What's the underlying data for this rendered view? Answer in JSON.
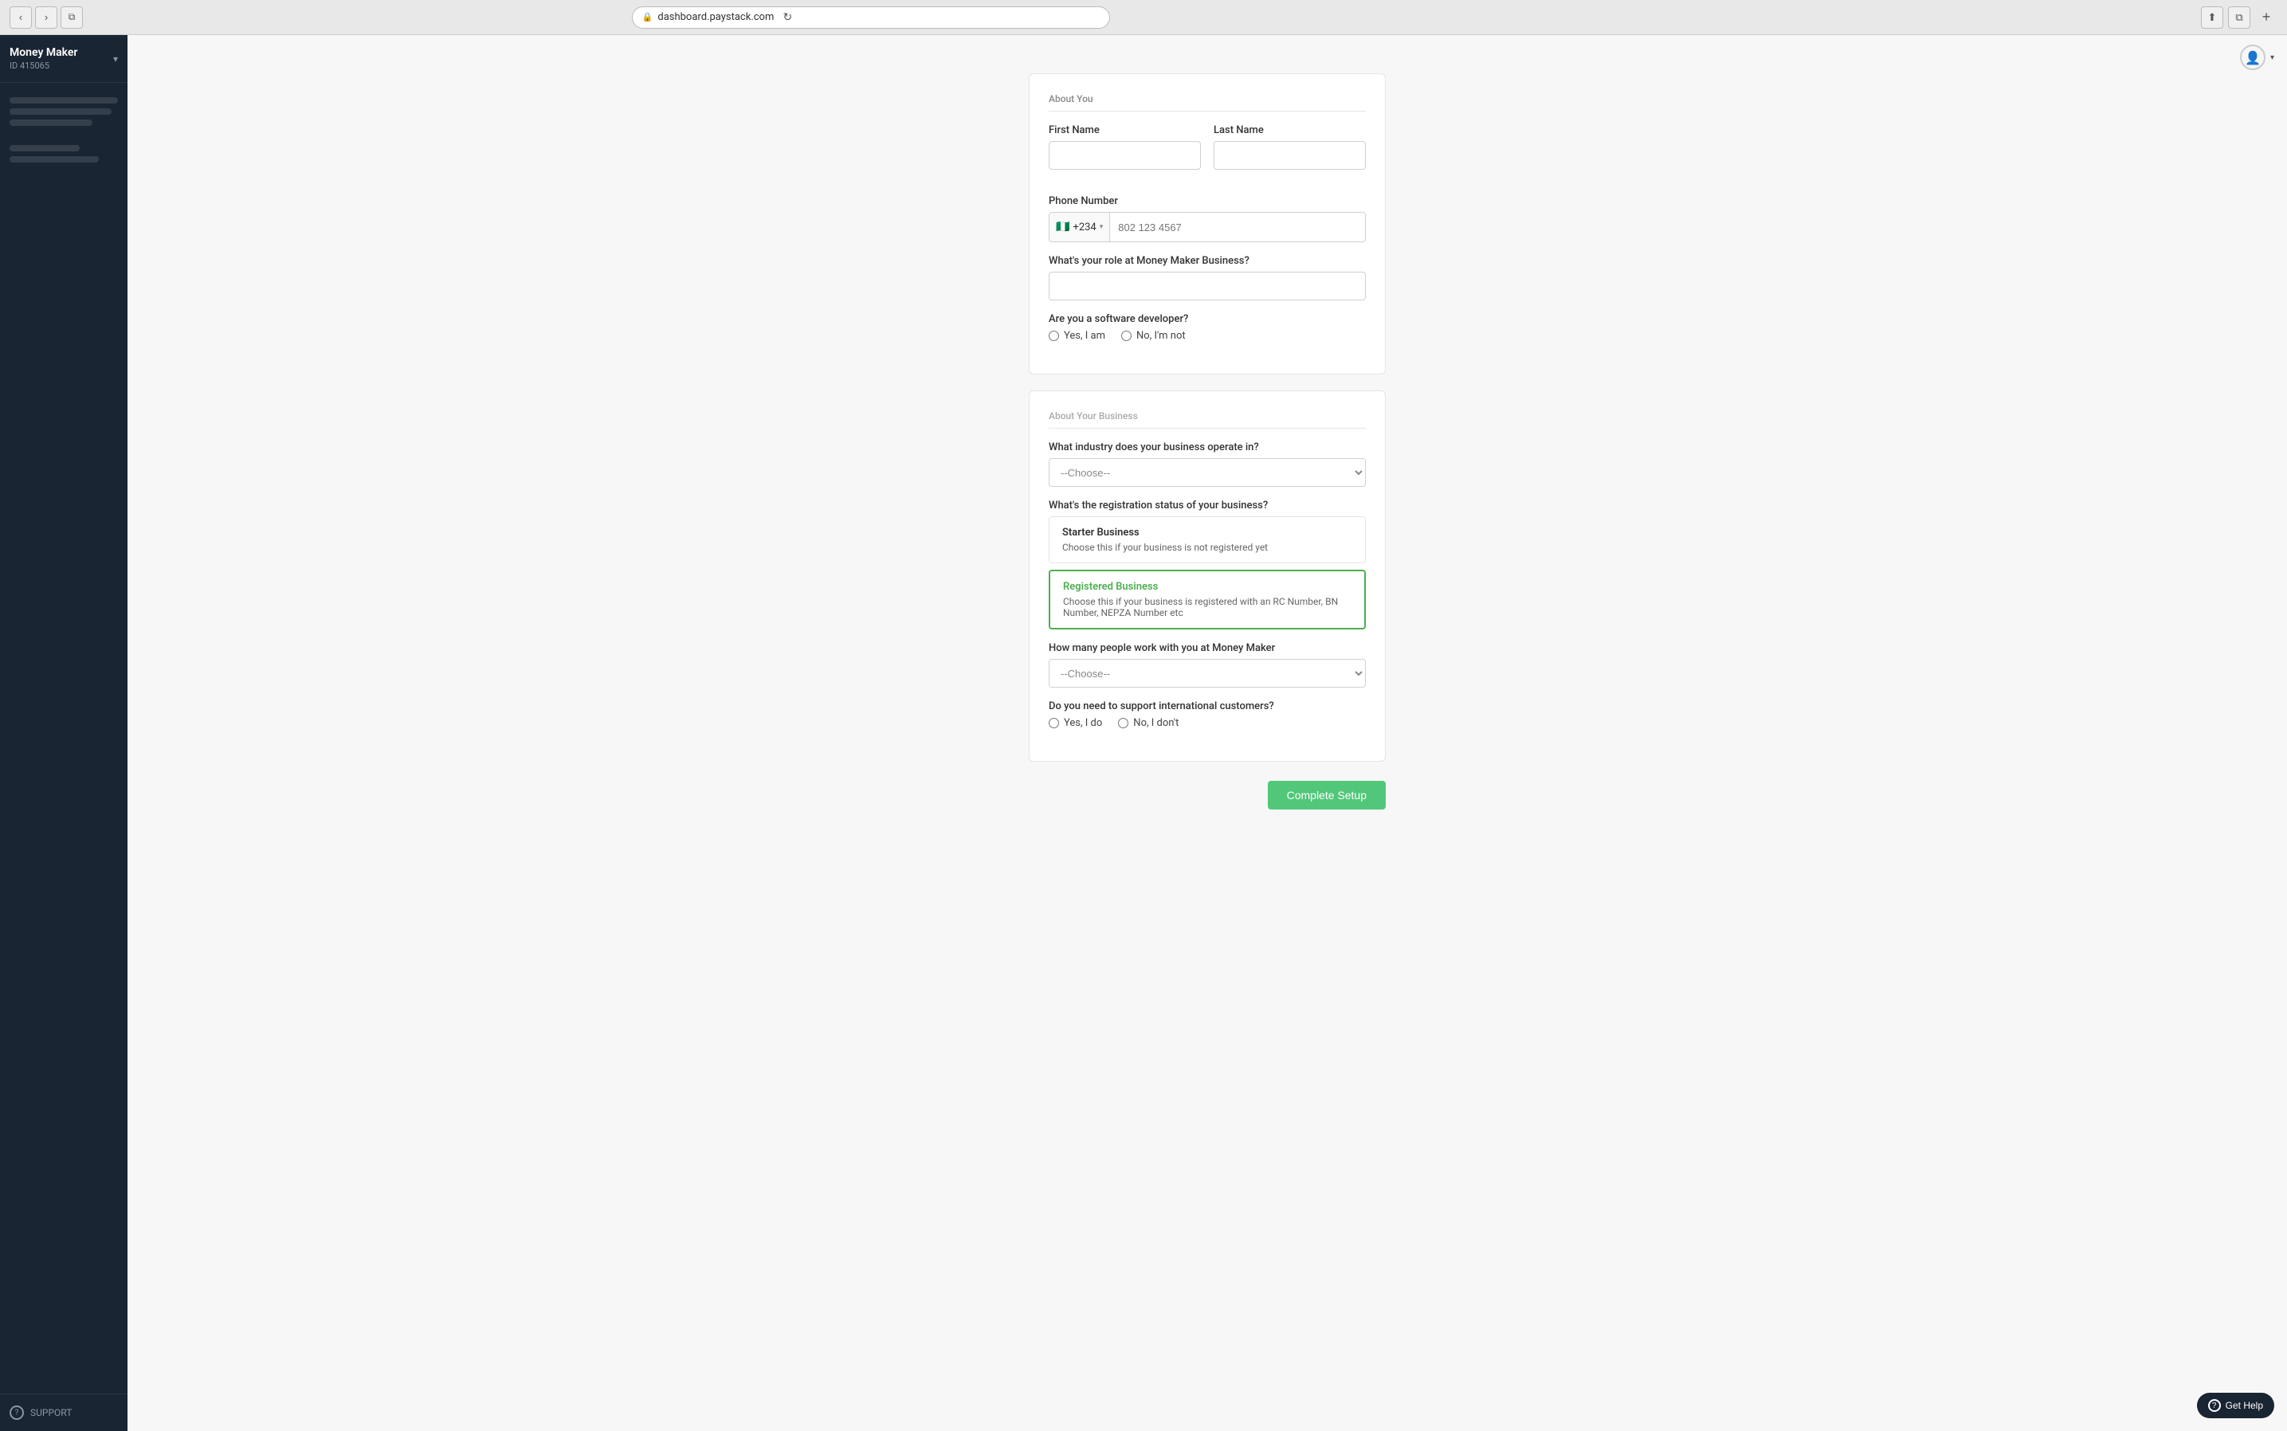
{
  "browser": {
    "url": "dashboard.paystack.com",
    "nav_back": "‹",
    "nav_forward": "›",
    "tab_icon": "⧉",
    "reload": "↻",
    "share": "⬆",
    "duplicate": "⧉",
    "new_tab": "+"
  },
  "sidebar": {
    "brand_name": "Money Maker",
    "brand_id": "ID 415065",
    "chevron": "▾",
    "nav_lines": [
      "full",
      "medium",
      "short"
    ],
    "support_label": "SUPPORT",
    "support_icon": "?"
  },
  "user": {
    "avatar_icon": "👤",
    "caret": "▾"
  },
  "form": {
    "about_you_title": "About You",
    "first_name_label": "First Name",
    "last_name_label": "Last Name",
    "phone_label": "Phone Number",
    "phone_flag": "🇳🇬",
    "phone_code": "+234",
    "phone_placeholder": "802 123 4567",
    "role_label": "What's your role at Money Maker Business?",
    "developer_label": "Are you a software developer?",
    "dev_yes": "Yes, I am",
    "dev_no": "No, I'm not",
    "about_business_title": "About Your Business",
    "industry_label": "What industry does your business operate in?",
    "industry_placeholder": "--Choose--",
    "registration_label": "What's the registration status of your business?",
    "starter_title": "Starter Business",
    "starter_desc": "Choose this if your business is not registered yet",
    "registered_title": "Registered Business",
    "registered_desc": "Choose this if your business is registered with an RC Number, BN Number, NEPZA Number etc",
    "employees_label": "How many people work with you at Money Maker",
    "employees_placeholder": "--Choose--",
    "international_label": "Do you need to support international customers?",
    "intl_yes": "Yes, I do",
    "intl_no": "No, I don't",
    "complete_btn": "Complete Setup"
  },
  "help": {
    "label": "Get Help",
    "icon": "?"
  }
}
